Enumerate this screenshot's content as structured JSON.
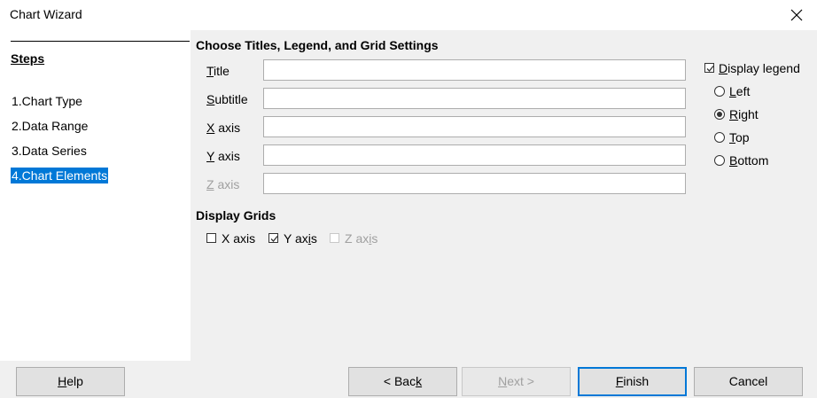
{
  "window": {
    "title": "Chart Wizard",
    "close_icon": "close-icon"
  },
  "steps": {
    "heading": "Steps",
    "items": [
      {
        "label": "1.Chart Type",
        "selected": false
      },
      {
        "label": "2.Data Range",
        "selected": false
      },
      {
        "label": "3.Data Series",
        "selected": false
      },
      {
        "label": "4.Chart Elements",
        "selected": true
      }
    ]
  },
  "titles": {
    "heading": "Choose Titles, Legend, and Grid Settings",
    "title_label_mn": "T",
    "title_label_rest": "itle",
    "title_value": "",
    "subtitle_label_mn": "S",
    "subtitle_label_rest": "ubtitle",
    "subtitle_value": "",
    "xaxis_label_mn": "X",
    "xaxis_label_rest": " axis",
    "xaxis_value": "",
    "yaxis_label_mn": "Y",
    "yaxis_label_rest": " axis",
    "yaxis_value": "",
    "zaxis_label_mn": "Z",
    "zaxis_label_rest": " axis",
    "zaxis_value": ""
  },
  "legend": {
    "display_label_mn": "D",
    "display_label_rest": "isplay legend",
    "display_checked": true,
    "positions": [
      {
        "mn": "L",
        "rest": "eft",
        "selected": false
      },
      {
        "mn": "R",
        "rest": "ight",
        "selected": true
      },
      {
        "mn": "T",
        "rest": "op",
        "selected": false
      },
      {
        "mn": "B",
        "rest": "ottom",
        "selected": false
      }
    ]
  },
  "grids": {
    "heading": "Display Grids",
    "x_label_pre": "X axis",
    "x_checked": false,
    "y_label_pre": "Y ax",
    "y_label_mn": "i",
    "y_label_post": "s",
    "y_checked": true,
    "z_label_pre": "Z ax",
    "z_label_mn": "i",
    "z_label_post": "s",
    "z_checked": false,
    "z_disabled": true
  },
  "buttons": {
    "help_mn": "H",
    "help_rest": "elp",
    "back_pre": "< Bac",
    "back_mn": "k",
    "next_mn": "N",
    "next_rest": "ext >",
    "finish_mn": "F",
    "finish_rest": "inish",
    "cancel": "Cancel"
  },
  "colors": {
    "selection": "#0078d7",
    "dialog_bg": "#f0f0f0"
  }
}
